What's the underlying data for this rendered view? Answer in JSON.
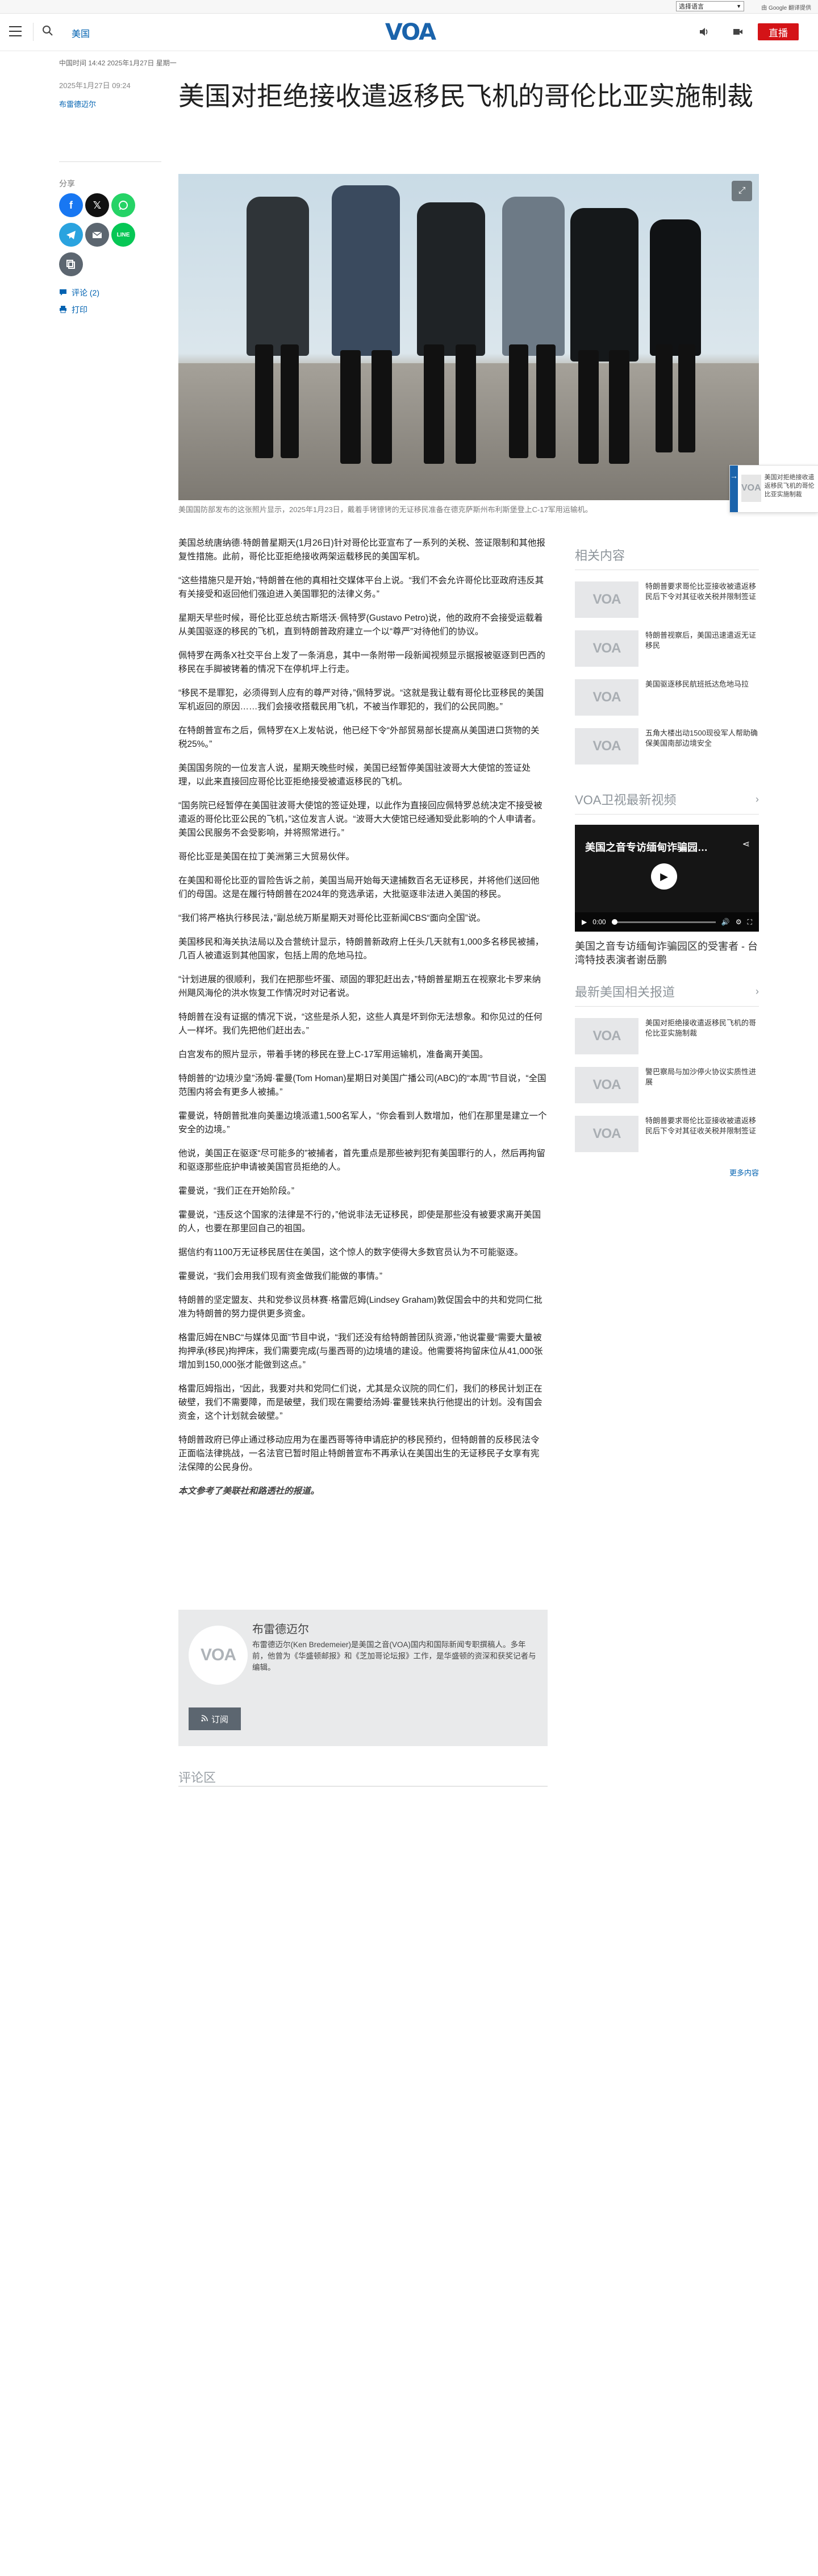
{
  "utility": {
    "language_select": "选择语言",
    "google_credit": "由 Google 翻译提供"
  },
  "header": {
    "section": "美国",
    "logo": "VOA",
    "live_label": "直播"
  },
  "meta": {
    "timestamp_top": "中国时间 14:42 2025年1月27日 星期一",
    "publish_date": "2025年1月27日 09:24",
    "author_link": "布雷德迈尔"
  },
  "article": {
    "title": "美国对拒绝接收遣返移民飞机的哥伦比亚实施制裁",
    "share_label": "分享",
    "comments_link": "评论 (2)",
    "print_link": "打印",
    "image_caption": "美国国防部发布的这张照片显示，2025年1月23日，戴着手铐镣铐的无证移民准备在德克萨斯州布利斯堡登上C-17军用运输机。",
    "paragraphs": [
      "美国总统唐纳德·特朗普星期天(1月26日)针对哥伦比亚宣布了一系列的关税、签证限制和其他报复性措施。此前，哥伦比亚拒绝接收两架运载移民的美国军机。",
      "“这些措施只是开始，”特朗普在他的真相社交媒体平台上说。“我们不会允许哥伦比亚政府违反其有关接受和返回他们强迫进入美国罪犯的法律义务。”",
      "星期天早些时候，哥伦比亚总统古斯塔沃·佩特罗(Gustavo Petro)说，他的政府不会接受运载着从美国驱逐的移民的飞机，直到特朗普政府建立一个以“尊严”对待他们的协议。",
      "佩特罗在两条X社交平台上发了一条消息，其中一条附带一段新闻视频显示据报被驱逐到巴西的移民在手脚被铐着的情况下在停机坪上行走。",
      "“移民不是罪犯，必须得到人应有的尊严对待，”佩特罗说。“这就是我让载有哥伦比亚移民的美国军机返回的原因……我们会接收搭载民用飞机，不被当作罪犯的，我们的公民同胞。”",
      "在特朗普宣布之后，佩特罗在X上发帖说，他已经下令“外部贸易部长提高从美国进口货物的关税25%。”",
      "美国国务院的一位发言人说，星期天晚些时候，美国已经暂停美国驻波哥大大使馆的签证处理，以此来直接回应哥伦比亚拒绝接受被遣返移民的飞机。",
      "“国务院已经暂停在美国驻波哥大使馆的签证处理，以此作为直接回应佩特罗总统决定不接受被遣返的哥伦比亚公民的飞机，”这位发言人说。“波哥大大使馆已经通知受此影响的个人申请者。美国公民服务不会受影响，并将照常进行。”",
      "哥伦比亚是美国在拉丁美洲第三大贸易伙伴。",
      "在美国和哥伦比亚的冒险告诉之前，美国当局开始每天逮捕数百名无证移民，并将他们送回他们的母国。这是在履行特朗普在2024年的竞选承诺，大批驱逐非法进入美国的移民。",
      "“我们将严格执行移民法，”副总统万斯星期天对哥伦比亚新闻CBS“面向全国”说。",
      "美国移民和海关执法局以及合营统计显示，特朗普新政府上任头几天就有1,000多名移民被捕，几百人被遣返到其他国家，包括上周的危地马拉。",
      "“计划进展的很顺利，我们在把那些坏蛋、顽固的罪犯赶出去，”特朗普星期五在视察北卡罗来纳州飓风海伦的洪水恢复工作情况时对记者说。",
      "特朗普在没有证据的情况下说，“这些是杀人犯，这些人真是坏到你无法想象。和你见过的任何人一样坏。我们先把他们赶出去。”",
      "白宫发布的照片显示，带着手铐的移民在登上C-17军用运输机，准备离开美国。",
      "特朗普的“边境沙皇”汤姆·霍曼(Tom Homan)星期日对美国广播公司(ABC)的“本周”节目说，“全国范围内将会有更多人被捕。”",
      "霍曼说，特朗普批准向美墨边境派遣1,500名军人，“你会看到人数增加，他们在那里是建立一个安全的边境。”",
      "他说，美国正在驱逐“尽可能多的”被捕者，首先重点是那些被判犯有美国罪行的人，然后再拘留和驱逐那些庇护申请被美国官员拒绝的人。",
      "霍曼说，“我们正在开始阶段。”",
      "霍曼说，“违反这个国家的法律是不行的，”他说非法无证移民，即使是那些没有被要求离开美国的人，也要在那里回自己的祖国。",
      "据信约有1100万无证移民居住在美国，这个惊人的数字使得大多数官员认为不可能驱逐。",
      "霍曼说，“我们会用我们现有资金做我们能做的事情。”",
      "特朗普的坚定盟友、共和党参议员林赛·格雷厄姆(Lindsey Graham)敦促国会中的共和党同仁批准为特朗普的努力提供更多资金。",
      "格雷厄姆在NBC“与媒体见面”节目中说，“我们还没有给特朗普团队资源，”他说霍曼“需要大量被拘押承(移民)拘押床，我们需要完成(与墨西哥的)边境墙的建设。他需要将拘留床位从41,000张增加到150,000张才能做到这点。”",
      "格雷厄姆指出，“因此，我要对共和党同仁们说，尤其是众议院的同仁们，我们的移民计划正在破壁，我们不需要障，而是破壁，我们现在需要给汤姆·霍曼钱来执行他提出的计划。没有国会资金，这个计划就会破壁。”",
      "特朗普政府已停止通过移动应用为在墨西哥等待申请庇护的移民预约，但特朗普的反移民法令正面临法律挑战，一名法官已暂时阻止特朗普宣布不再承认在美国出生的无证移民子女享有宪法保障的公民身份。"
    ],
    "source_note": "本文参考了美联社和路透社的报道。"
  },
  "author": {
    "name": "布雷德迈尔",
    "bio": "布雷德迈尔(Ken Bredemeier)是美国之音(VOA)国内和国际新闻专职撰稿人。多年前，他曾为《华盛顿邮报》和《芝加哥论坛报》工作，是华盛顿的资深和获奖记者与编辑。",
    "subscribe_label": "订阅"
  },
  "comments": {
    "title": "评论区"
  },
  "floating": {
    "text": "美国对拒绝接收遣返移民飞机的哥伦比亚实施制裁"
  },
  "rail": {
    "related_title": "相关内容",
    "related": [
      {
        "text": "特朗普要求哥伦比亚接收被遣返移民后下令对其征收关税并限制签证"
      },
      {
        "text": "特朗普视察后，美国迅速遣返无证移民"
      },
      {
        "text": "美国驱逐移民航班抵达危地马拉"
      },
      {
        "text": "五角大楼出动1500现役军人帮助确保美国南部边境安全"
      }
    ],
    "video_title": "VOA卫视最新视频",
    "video": {
      "player_title": "美国之音专访缅甸诈骗园…",
      "time": "0:00",
      "caption": "美国之音专访缅甸诈骗园区的受害者 - 台湾特技表演者谢岳鹏"
    },
    "latest_title": "最新美国相关报道",
    "latest": [
      {
        "text": "美国对拒绝接收遣返移民飞机的哥伦比亚实施制裁"
      },
      {
        "text": "警巴察局与加沙停火协议实质性进展"
      },
      {
        "text": "特朗普要求哥伦比亚接收被遣返移民后下令对其征收关税并限制签证"
      }
    ],
    "more_label": "更多内容"
  },
  "colors": {
    "link": "#0162b1",
    "live": "#d41317",
    "logo": "#1a63ab"
  },
  "share_icons": [
    "facebook-icon",
    "x-icon",
    "whatsapp-icon",
    "telegram-icon",
    "email-icon",
    "line-icon",
    "copy-link-icon"
  ]
}
